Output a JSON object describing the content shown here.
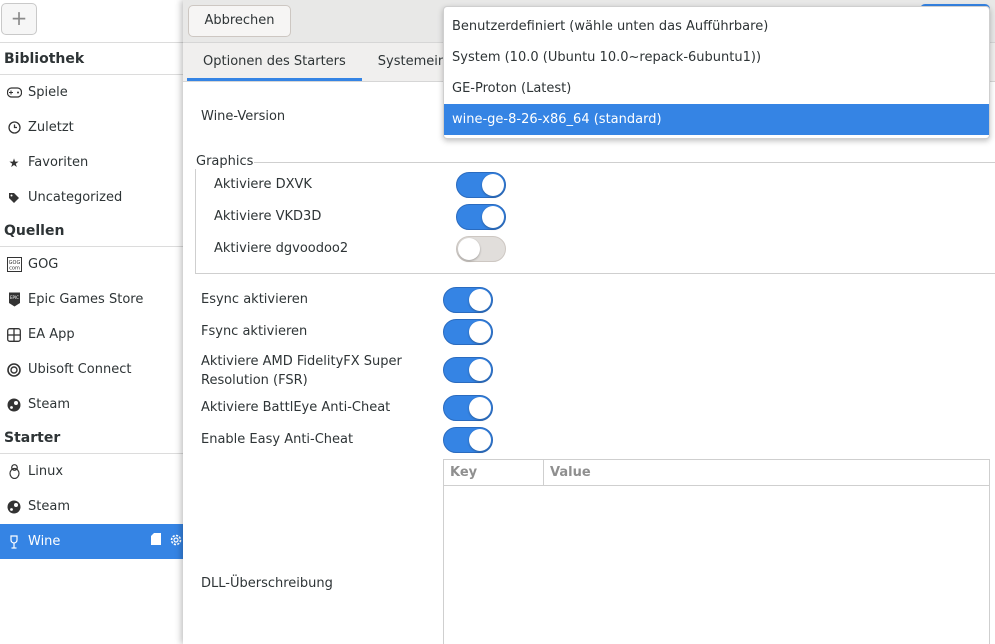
{
  "sidebar": {
    "add_label": "+",
    "sections": [
      {
        "title": "Bibliothek",
        "items": [
          {
            "label": "Spiele",
            "icon": "gamepad-icon"
          },
          {
            "label": "Zuletzt",
            "icon": "clock-icon"
          },
          {
            "label": "Favoriten",
            "icon": "star-icon"
          },
          {
            "label": "Uncategorized",
            "icon": "tag-icon"
          }
        ]
      },
      {
        "title": "Quellen",
        "items": [
          {
            "label": "GOG",
            "icon": "gog-icon"
          },
          {
            "label": "Epic Games Store",
            "icon": "epic-icon"
          },
          {
            "label": "EA App",
            "icon": "ea-icon"
          },
          {
            "label": "Ubisoft Connect",
            "icon": "ubisoft-icon"
          },
          {
            "label": "Steam",
            "icon": "steam-icon"
          }
        ]
      },
      {
        "title": "Starter",
        "items": [
          {
            "label": "Linux",
            "icon": "linux-icon"
          },
          {
            "label": "Steam",
            "icon": "steam-icon"
          },
          {
            "label": "Wine",
            "icon": "wine-icon"
          }
        ]
      }
    ]
  },
  "dialog": {
    "cancel_label": "Abbrechen",
    "tabs": [
      "Optionen des Starters",
      "Systemeinst"
    ],
    "wine_version_label": "Wine-Version",
    "graphics_title": "Graphics",
    "graphics_options": [
      {
        "label": "Aktiviere DXVK",
        "on": true
      },
      {
        "label": "Aktiviere VKD3D",
        "on": true
      },
      {
        "label": "Aktiviere dgvoodoo2",
        "on": false
      }
    ],
    "options": [
      {
        "label": "Esync aktivieren",
        "on": true
      },
      {
        "label": "Fsync aktivieren",
        "on": true
      },
      {
        "label": "Aktiviere AMD FidelityFX Super Resolution (FSR)",
        "on": true
      },
      {
        "label": "Aktiviere BattlEye Anti-Cheat",
        "on": true
      },
      {
        "label": "Enable Easy Anti-Cheat",
        "on": true
      }
    ],
    "dll_label": "DLL-Überschreibung",
    "kv_key": "Key",
    "kv_value": "Value"
  },
  "dropdown": {
    "options": [
      "Benutzerdefiniert (wähle unten das Aufführbare)",
      "System (10.0 (Ubuntu 10.0~repack-6ubuntu1))",
      "GE-Proton (Latest)",
      "wine-ge-8-26-x86_64 (standard)"
    ],
    "selected": "wine-ge-8-26-x86_64 (standard)"
  },
  "colors": {
    "accent": "#3584e4"
  }
}
